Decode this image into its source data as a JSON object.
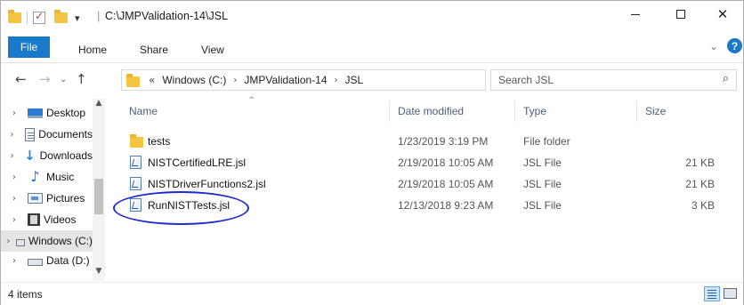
{
  "titlebar": {
    "path": "C:\\JMPValidation-14\\JSL",
    "pipe": "|",
    "dropdown": "▾"
  },
  "window_controls": {
    "close_glyph": "✕"
  },
  "ribbon": {
    "tabs": [
      "File",
      "Home",
      "Share",
      "View"
    ]
  },
  "address": {
    "lead": "«",
    "crumbs": [
      "Windows (C:)",
      "JMPValidation-14",
      "JSL"
    ],
    "search_placeholder": "Search JSL"
  },
  "nav_pane": {
    "items": [
      {
        "label": "Desktop",
        "icon": "desktop-icon"
      },
      {
        "label": "Documents",
        "icon": "documents-icon"
      },
      {
        "label": "Downloads",
        "icon": "downloads-icon"
      },
      {
        "label": "Music",
        "icon": "music-icon"
      },
      {
        "label": "Pictures",
        "icon": "pictures-icon"
      },
      {
        "label": "Videos",
        "icon": "videos-icon"
      },
      {
        "label": "Windows (C:)",
        "icon": "drive-icon",
        "selected": true
      },
      {
        "label": "Data (D:)",
        "icon": "drive-icon"
      }
    ]
  },
  "columns": {
    "name": "Name",
    "date": "Date modified",
    "type": "Type",
    "size": "Size"
  },
  "files": [
    {
      "name": "tests",
      "date": "1/23/2019 3:19 PM",
      "type": "File folder",
      "size": "",
      "icon": "folder-icon"
    },
    {
      "name": "NISTCertifiedLRE.jsl",
      "date": "2/19/2018 10:05 AM",
      "type": "JSL File",
      "size": "21 KB",
      "icon": "jsl-file-icon"
    },
    {
      "name": "NISTDriverFunctions2.jsl",
      "date": "2/19/2018 10:05 AM",
      "type": "JSL File",
      "size": "21 KB",
      "icon": "jsl-file-icon"
    },
    {
      "name": "RunNISTTests.jsl",
      "date": "12/13/2018 9:23 AM",
      "type": "JSL File",
      "size": "3 KB",
      "icon": "jsl-file-icon"
    }
  ],
  "status": {
    "item_count": "4 items"
  },
  "colors": {
    "accent": "#1979ca",
    "highlight_ellipse": "#1f2bd1",
    "folder": "#f5c542"
  }
}
